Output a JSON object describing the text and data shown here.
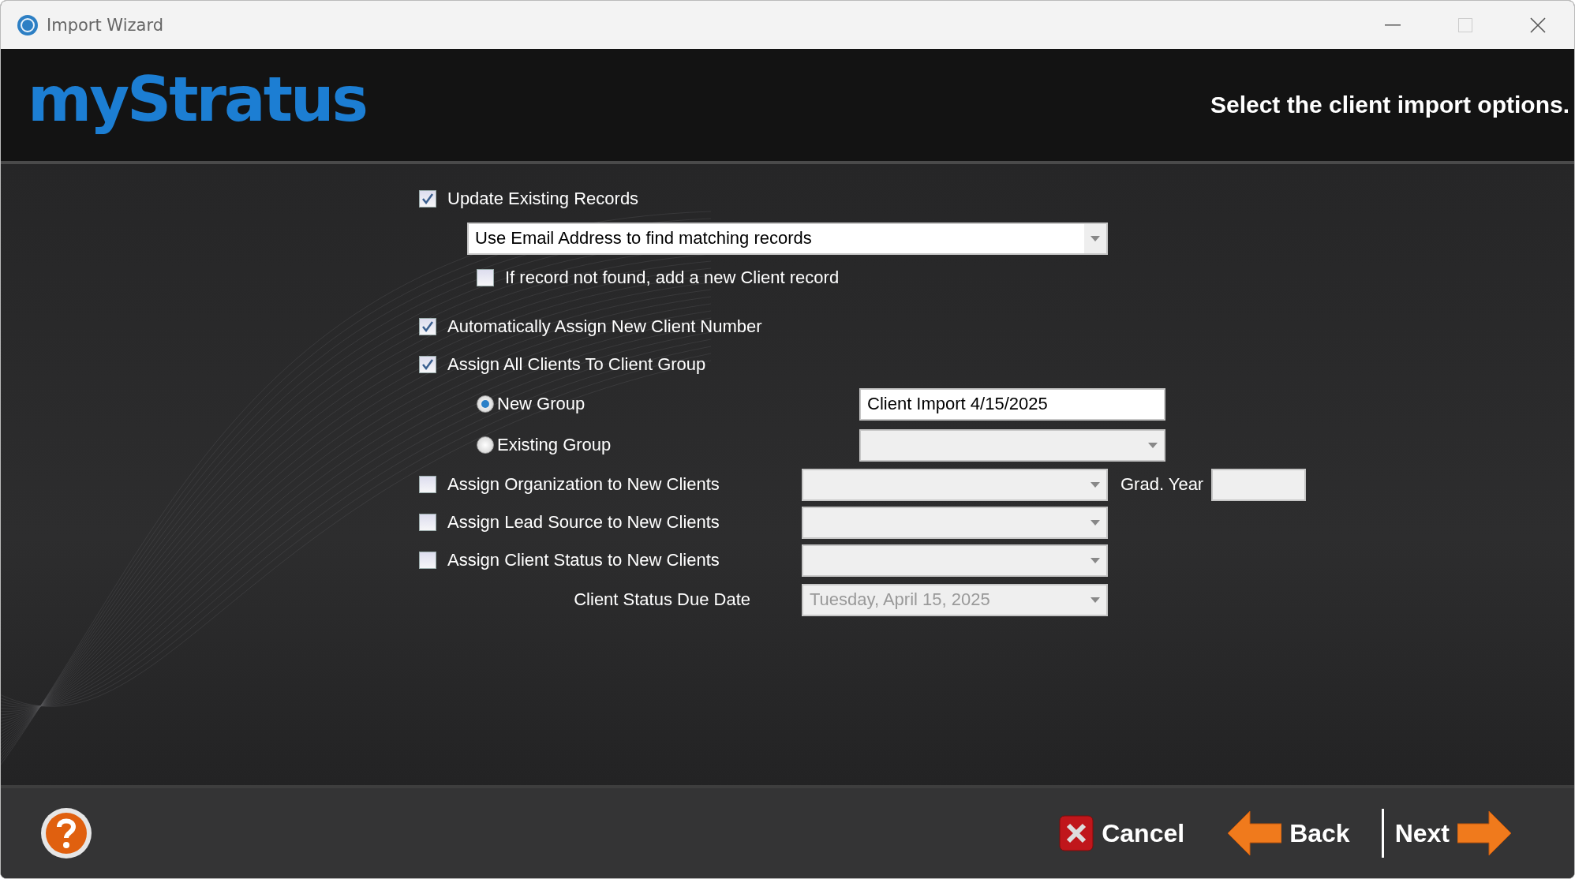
{
  "window": {
    "title": "Import Wizard"
  },
  "header": {
    "logo": "myStratus",
    "instruction": "Select the client import options."
  },
  "options": [
    {
      "kind": "checkbox",
      "label": "Update Existing Records",
      "checked": true
    },
    {
      "kind": "dropdown",
      "value": "Use Email Address to find matching records",
      "disabled": false
    },
    {
      "kind": "sub_checkbox",
      "label": "If record not found, add a new Client record",
      "checked": false
    },
    {
      "kind": "checkbox",
      "label": "Automatically Assign New Client Number",
      "checked": true
    },
    {
      "kind": "checkbox",
      "label": "Assign All Clients To Client Group",
      "checked": true
    },
    {
      "kind": "radio",
      "label": "New Group",
      "selected": true,
      "field": {
        "kind": "text",
        "value": "Client Import 4/15/2025",
        "disabled": false
      }
    },
    {
      "kind": "radio",
      "label": "Existing Group",
      "selected": false,
      "field": {
        "kind": "dropdown",
        "disabled": true
      }
    },
    {
      "kind": "checkbox",
      "label": "Assign Organization to New Clients",
      "checked": false,
      "field": {
        "kind": "dropdown",
        "disabled": true
      },
      "extra": {
        "label": "Grad. Year",
        "field": {
          "kind": "text",
          "disabled": true
        }
      }
    },
    {
      "kind": "checkbox",
      "label": "Assign Lead Source to New Clients",
      "checked": false,
      "field": {
        "kind": "dropdown",
        "disabled": true
      }
    },
    {
      "kind": "checkbox",
      "label": "Assign Client Status to New Clients",
      "checked": false,
      "field": {
        "kind": "dropdown",
        "disabled": true
      }
    },
    {
      "kind": "label",
      "label": "Client Status Due Date",
      "field": {
        "kind": "dropdown",
        "value": "Tuesday, April 15, 2025",
        "disabled": true
      }
    }
  ],
  "footer": {
    "buttons": [
      {
        "kind": "cancel",
        "label": "Cancel"
      },
      {
        "kind": "back",
        "label": "Back"
      },
      {
        "kind": "next",
        "label": "Next"
      }
    ]
  }
}
